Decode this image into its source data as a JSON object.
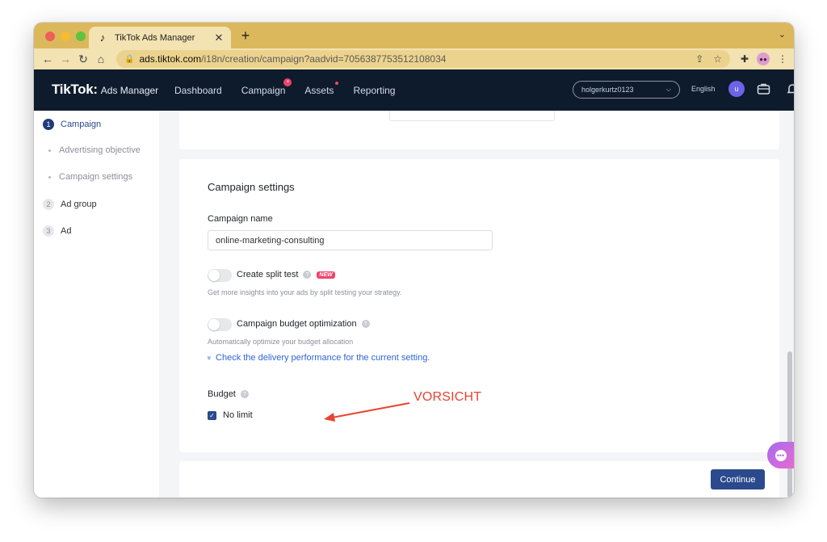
{
  "browser": {
    "tab_title": "TikTok Ads Manager",
    "tab_icon": "tiktok-icon",
    "close_glyph": "✕",
    "new_tab_glyph": "+",
    "menu_glyph": "⌄",
    "url_host": "ads.tiktok.com",
    "url_path": "/i18n/creation/campaign?aadvid=7056387753512108034",
    "colors": {
      "tab_bar": "#dcb85c",
      "toolbar": "#f3e2b2"
    }
  },
  "header": {
    "logo_main": "TikTok",
    "logo_dot": ":",
    "logo_sub": "Ads Manager",
    "nav": [
      {
        "label": "Dashboard"
      },
      {
        "label": "Campaign"
      },
      {
        "label": "Assets"
      },
      {
        "label": "Reporting"
      }
    ],
    "account": "holgerkurtz0123",
    "language": "English",
    "avatar_letter": "u",
    "colors": {
      "background": "#0e1b2d",
      "badge": "#f0436a",
      "avatar": "#6c63e6"
    }
  },
  "sidebar": {
    "steps": [
      {
        "num": "1",
        "label": "Campaign"
      },
      {
        "label": "Advertising objective"
      },
      {
        "label": "Campaign settings"
      },
      {
        "num": "2",
        "label": "Ad group"
      },
      {
        "num": "3",
        "label": "Ad"
      }
    ]
  },
  "settings": {
    "title": "Campaign settings",
    "campaign_name_label": "Campaign name",
    "campaign_name_value": "online-marketing-consulting",
    "split_test_label": "Create split test",
    "new_badge": "NEW",
    "split_test_hint": "Get more insights into your ads by split testing your strategy.",
    "cbo_label": "Campaign budget optimization",
    "cbo_hint": "Automatically optimize your budget allocation",
    "delivery_link": "Check the delivery performance for the current setting.",
    "budget_label": "Budget",
    "no_limit_label": "No limit",
    "help_glyph": "?",
    "check_glyph": "✓",
    "expand_glyph": "»"
  },
  "annotation": {
    "text": "VORSICHT",
    "color": "#e8432f"
  },
  "footer": {
    "continue_label": "Continue",
    "accent": "#2a4a8c"
  }
}
